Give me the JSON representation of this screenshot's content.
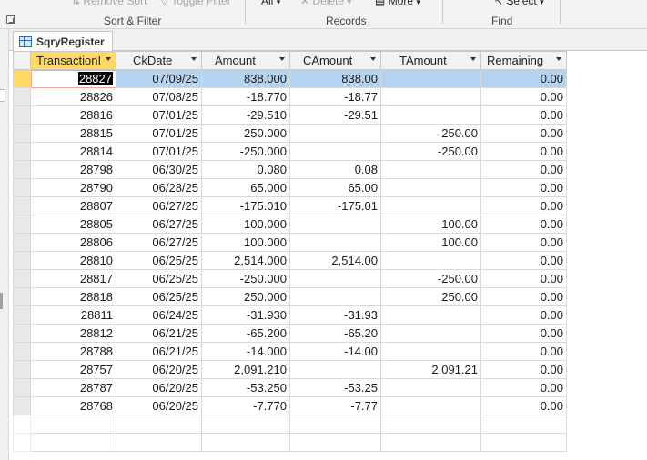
{
  "ribbon": {
    "items": {
      "remove_sort": "Remove Sort",
      "toggle_filter": "Toggle Filter",
      "all": "All",
      "delete": "Delete",
      "more": "More",
      "select": "Select"
    },
    "groups": {
      "sort_filter": "Sort & Filter",
      "records": "Records",
      "find": "Find"
    }
  },
  "tab": {
    "label": "SqryRegister"
  },
  "datasheet": {
    "columns": [
      "TransactionI",
      "CkDate",
      "Amount",
      "CAmount",
      "TAmount",
      "Remaining"
    ],
    "rows": [
      [
        "28827",
        "07/09/25",
        "838.000",
        "838.00",
        "",
        "0.00"
      ],
      [
        "28826",
        "07/08/25",
        "-18.770",
        "-18.77",
        "",
        "0.00"
      ],
      [
        "28816",
        "07/01/25",
        "-29.510",
        "-29.51",
        "",
        "0.00"
      ],
      [
        "28815",
        "07/01/25",
        "250.000",
        "",
        "250.00",
        "0.00"
      ],
      [
        "28814",
        "07/01/25",
        "-250.000",
        "",
        "-250.00",
        "0.00"
      ],
      [
        "28798",
        "06/30/25",
        "0.080",
        "0.08",
        "",
        "0.00"
      ],
      [
        "28790",
        "06/28/25",
        "65.000",
        "65.00",
        "",
        "0.00"
      ],
      [
        "28807",
        "06/27/25",
        "-175.010",
        "-175.01",
        "",
        "0.00"
      ],
      [
        "28805",
        "06/27/25",
        "-100.000",
        "",
        "-100.00",
        "0.00"
      ],
      [
        "28806",
        "06/27/25",
        "100.000",
        "",
        "100.00",
        "0.00"
      ],
      [
        "28810",
        "06/25/25",
        "2,514.000",
        "2,514.00",
        "",
        "0.00"
      ],
      [
        "28817",
        "06/25/25",
        "-250.000",
        "",
        "-250.00",
        "0.00"
      ],
      [
        "28818",
        "06/25/25",
        "250.000",
        "",
        "250.00",
        "0.00"
      ],
      [
        "28811",
        "06/24/25",
        "-31.930",
        "-31.93",
        "",
        "0.00"
      ],
      [
        "28812",
        "06/21/25",
        "-65.200",
        "-65.20",
        "",
        "0.00"
      ],
      [
        "28788",
        "06/21/25",
        "-14.000",
        "-14.00",
        "",
        "0.00"
      ],
      [
        "28757",
        "06/20/25",
        "2,091.210",
        "",
        "2,091.21",
        "0.00"
      ],
      [
        "28787",
        "06/20/25",
        "-53.250",
        "-53.25",
        "",
        "0.00"
      ],
      [
        "28768",
        "06/20/25",
        "-7.770",
        "-7.77",
        "",
        "0.00"
      ]
    ],
    "current_row": 0
  },
  "colors": {
    "accent_header": "#ffd964",
    "current_row": "#b4d3f1",
    "selection": "#000000"
  }
}
